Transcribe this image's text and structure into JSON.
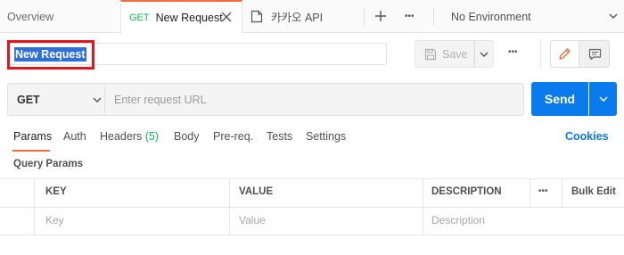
{
  "tabbar": {
    "overview_label": "Overview",
    "active_tab": {
      "method": "GET",
      "title": "New Request"
    },
    "second_tab": {
      "title": "카카오 API"
    },
    "more_label": "•••",
    "environment": "No Environment"
  },
  "request": {
    "name": "New Request",
    "save_label": "Save",
    "more_label": "•••",
    "method": "GET",
    "url_placeholder": "Enter request URL",
    "send_label": "Send"
  },
  "subtabs": [
    {
      "label": "Params"
    },
    {
      "label": "Auth"
    },
    {
      "label": "Headers",
      "count": "(5)"
    },
    {
      "label": "Body"
    },
    {
      "label": "Pre-req."
    },
    {
      "label": "Tests"
    },
    {
      "label": "Settings"
    }
  ],
  "cookies_label": "Cookies",
  "query_params": {
    "title": "Query Params",
    "headers": {
      "key": "KEY",
      "value": "VALUE",
      "description": "DESCRIPTION",
      "more": "•••",
      "bulk_edit": "Bulk Edit"
    },
    "placeholders": {
      "key": "Key",
      "value": "Value",
      "description": "Description"
    }
  },
  "colors": {
    "accent": "#f26b3a",
    "send": "#097bed",
    "method_green": "#0cbb52",
    "highlight": "#e3141a"
  }
}
